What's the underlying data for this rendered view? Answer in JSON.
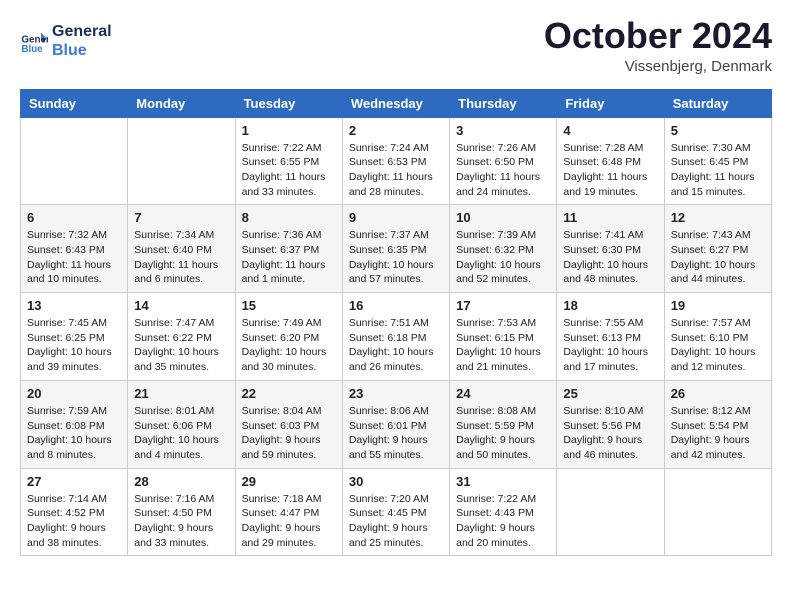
{
  "header": {
    "logo_line1": "General",
    "logo_line2": "Blue",
    "month": "October 2024",
    "location": "Vissenbjerg, Denmark"
  },
  "weekdays": [
    "Sunday",
    "Monday",
    "Tuesday",
    "Wednesday",
    "Thursday",
    "Friday",
    "Saturday"
  ],
  "weeks": [
    [
      {
        "day": "",
        "sunrise": "",
        "sunset": "",
        "daylight": ""
      },
      {
        "day": "",
        "sunrise": "",
        "sunset": "",
        "daylight": ""
      },
      {
        "day": "1",
        "sunrise": "Sunrise: 7:22 AM",
        "sunset": "Sunset: 6:55 PM",
        "daylight": "Daylight: 11 hours and 33 minutes."
      },
      {
        "day": "2",
        "sunrise": "Sunrise: 7:24 AM",
        "sunset": "Sunset: 6:53 PM",
        "daylight": "Daylight: 11 hours and 28 minutes."
      },
      {
        "day": "3",
        "sunrise": "Sunrise: 7:26 AM",
        "sunset": "Sunset: 6:50 PM",
        "daylight": "Daylight: 11 hours and 24 minutes."
      },
      {
        "day": "4",
        "sunrise": "Sunrise: 7:28 AM",
        "sunset": "Sunset: 6:48 PM",
        "daylight": "Daylight: 11 hours and 19 minutes."
      },
      {
        "day": "5",
        "sunrise": "Sunrise: 7:30 AM",
        "sunset": "Sunset: 6:45 PM",
        "daylight": "Daylight: 11 hours and 15 minutes."
      }
    ],
    [
      {
        "day": "6",
        "sunrise": "Sunrise: 7:32 AM",
        "sunset": "Sunset: 6:43 PM",
        "daylight": "Daylight: 11 hours and 10 minutes."
      },
      {
        "day": "7",
        "sunrise": "Sunrise: 7:34 AM",
        "sunset": "Sunset: 6:40 PM",
        "daylight": "Daylight: 11 hours and 6 minutes."
      },
      {
        "day": "8",
        "sunrise": "Sunrise: 7:36 AM",
        "sunset": "Sunset: 6:37 PM",
        "daylight": "Daylight: 11 hours and 1 minute."
      },
      {
        "day": "9",
        "sunrise": "Sunrise: 7:37 AM",
        "sunset": "Sunset: 6:35 PM",
        "daylight": "Daylight: 10 hours and 57 minutes."
      },
      {
        "day": "10",
        "sunrise": "Sunrise: 7:39 AM",
        "sunset": "Sunset: 6:32 PM",
        "daylight": "Daylight: 10 hours and 52 minutes."
      },
      {
        "day": "11",
        "sunrise": "Sunrise: 7:41 AM",
        "sunset": "Sunset: 6:30 PM",
        "daylight": "Daylight: 10 hours and 48 minutes."
      },
      {
        "day": "12",
        "sunrise": "Sunrise: 7:43 AM",
        "sunset": "Sunset: 6:27 PM",
        "daylight": "Daylight: 10 hours and 44 minutes."
      }
    ],
    [
      {
        "day": "13",
        "sunrise": "Sunrise: 7:45 AM",
        "sunset": "Sunset: 6:25 PM",
        "daylight": "Daylight: 10 hours and 39 minutes."
      },
      {
        "day": "14",
        "sunrise": "Sunrise: 7:47 AM",
        "sunset": "Sunset: 6:22 PM",
        "daylight": "Daylight: 10 hours and 35 minutes."
      },
      {
        "day": "15",
        "sunrise": "Sunrise: 7:49 AM",
        "sunset": "Sunset: 6:20 PM",
        "daylight": "Daylight: 10 hours and 30 minutes."
      },
      {
        "day": "16",
        "sunrise": "Sunrise: 7:51 AM",
        "sunset": "Sunset: 6:18 PM",
        "daylight": "Daylight: 10 hours and 26 minutes."
      },
      {
        "day": "17",
        "sunrise": "Sunrise: 7:53 AM",
        "sunset": "Sunset: 6:15 PM",
        "daylight": "Daylight: 10 hours and 21 minutes."
      },
      {
        "day": "18",
        "sunrise": "Sunrise: 7:55 AM",
        "sunset": "Sunset: 6:13 PM",
        "daylight": "Daylight: 10 hours and 17 minutes."
      },
      {
        "day": "19",
        "sunrise": "Sunrise: 7:57 AM",
        "sunset": "Sunset: 6:10 PM",
        "daylight": "Daylight: 10 hours and 12 minutes."
      }
    ],
    [
      {
        "day": "20",
        "sunrise": "Sunrise: 7:59 AM",
        "sunset": "Sunset: 6:08 PM",
        "daylight": "Daylight: 10 hours and 8 minutes."
      },
      {
        "day": "21",
        "sunrise": "Sunrise: 8:01 AM",
        "sunset": "Sunset: 6:06 PM",
        "daylight": "Daylight: 10 hours and 4 minutes."
      },
      {
        "day": "22",
        "sunrise": "Sunrise: 8:04 AM",
        "sunset": "Sunset: 6:03 PM",
        "daylight": "Daylight: 9 hours and 59 minutes."
      },
      {
        "day": "23",
        "sunrise": "Sunrise: 8:06 AM",
        "sunset": "Sunset: 6:01 PM",
        "daylight": "Daylight: 9 hours and 55 minutes."
      },
      {
        "day": "24",
        "sunrise": "Sunrise: 8:08 AM",
        "sunset": "Sunset: 5:59 PM",
        "daylight": "Daylight: 9 hours and 50 minutes."
      },
      {
        "day": "25",
        "sunrise": "Sunrise: 8:10 AM",
        "sunset": "Sunset: 5:56 PM",
        "daylight": "Daylight: 9 hours and 46 minutes."
      },
      {
        "day": "26",
        "sunrise": "Sunrise: 8:12 AM",
        "sunset": "Sunset: 5:54 PM",
        "daylight": "Daylight: 9 hours and 42 minutes."
      }
    ],
    [
      {
        "day": "27",
        "sunrise": "Sunrise: 7:14 AM",
        "sunset": "Sunset: 4:52 PM",
        "daylight": "Daylight: 9 hours and 38 minutes."
      },
      {
        "day": "28",
        "sunrise": "Sunrise: 7:16 AM",
        "sunset": "Sunset: 4:50 PM",
        "daylight": "Daylight: 9 hours and 33 minutes."
      },
      {
        "day": "29",
        "sunrise": "Sunrise: 7:18 AM",
        "sunset": "Sunset: 4:47 PM",
        "daylight": "Daylight: 9 hours and 29 minutes."
      },
      {
        "day": "30",
        "sunrise": "Sunrise: 7:20 AM",
        "sunset": "Sunset: 4:45 PM",
        "daylight": "Daylight: 9 hours and 25 minutes."
      },
      {
        "day": "31",
        "sunrise": "Sunrise: 7:22 AM",
        "sunset": "Sunset: 4:43 PM",
        "daylight": "Daylight: 9 hours and 20 minutes."
      },
      {
        "day": "",
        "sunrise": "",
        "sunset": "",
        "daylight": ""
      },
      {
        "day": "",
        "sunrise": "",
        "sunset": "",
        "daylight": ""
      }
    ]
  ]
}
